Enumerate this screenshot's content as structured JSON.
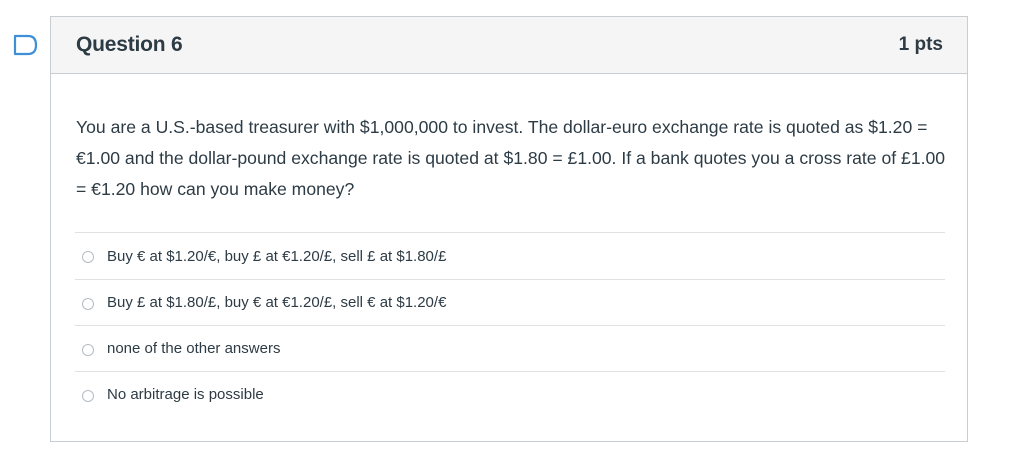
{
  "question": {
    "title": "Question 6",
    "points": "1 pts",
    "text": "You are a U.S.-based treasurer with $1,000,000 to invest. The dollar-euro exchange rate is quoted as $1.20 = €1.00 and the dollar-pound exchange rate is quoted at $1.80 = £1.00. If a bank quotes you a cross rate of £1.00 = €1.20 how can you make money?"
  },
  "answers": [
    {
      "label": "Buy € at $1.20/€, buy £ at €1.20/£, sell £ at $1.80/£",
      "selected": false
    },
    {
      "label": "Buy £ at $1.80/£, buy € at €1.20/£, sell € at $1.20/€",
      "selected": false
    },
    {
      "label": "none of the other answers",
      "selected": false
    },
    {
      "label": "No arbitrage is possible",
      "selected": false
    }
  ],
  "icons": {
    "flag": "flag-question-icon",
    "radio": "radio-button-icon"
  },
  "colors": {
    "flag": "#3f8fd6",
    "header_bg": "#f5f5f5",
    "border": "#c7cdd1",
    "text": "#2d3b45"
  }
}
